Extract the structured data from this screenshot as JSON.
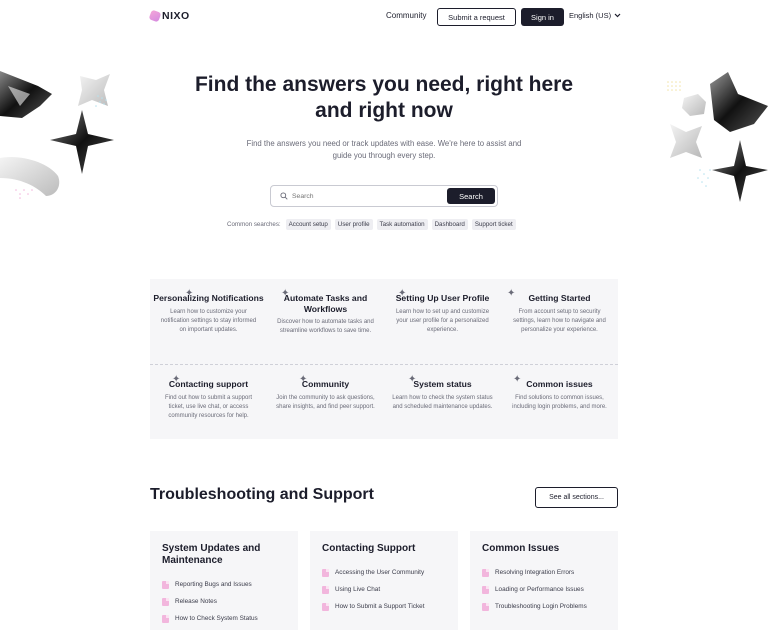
{
  "header": {
    "logo_text": "NIXO",
    "nav_community": "Community",
    "submit_request": "Submit a request",
    "sign_in": "Sign in",
    "language": "English (US)"
  },
  "hero": {
    "title": "Find the answers you need, right here and right now",
    "subtitle": "Find the answers you need or track updates with ease. We're here to assist and guide you through every step.",
    "search_placeholder": "Search",
    "search_button": "Search",
    "common_label": "Common searches:",
    "common_searches": [
      "Account setup",
      "User profile",
      "Task automation",
      "Dashboard",
      "Support ticket"
    ]
  },
  "categories": [
    {
      "title": "Personalizing Notifications",
      "desc": "Learn how to customize your notification settings to stay informed on important updates."
    },
    {
      "title": "Automate Tasks and Workflows",
      "desc": "Discover how to automate tasks and streamline workflows to save time."
    },
    {
      "title": "Setting Up User Profile",
      "desc": "Learn how to set up and customize your user profile for a personalized experience."
    },
    {
      "title": "Getting Started",
      "desc": "From account setup to security settings, learn how to navigate and personalize your experience."
    },
    {
      "title": "Contacting support",
      "desc": "Find out how to submit a support ticket, use live chat, or access community resources for help."
    },
    {
      "title": "Community",
      "desc": "Join the community to ask questions, share insights, and find peer support."
    },
    {
      "title": "System status",
      "desc": "Learn how to check the system status and scheduled maintenance updates."
    },
    {
      "title": "Common issues",
      "desc": "Find solutions to common issues, including login problems, and more."
    }
  ],
  "troubleshooting": {
    "title": "Troubleshooting and Support",
    "see_all": "See all sections...",
    "cards": [
      {
        "title": "System Updates and Maintenance",
        "items": [
          "Reporting Bugs and Issues",
          "Release Notes",
          "How to Check System Status"
        ]
      },
      {
        "title": "Contacting Support",
        "items": [
          "Accessing the User Community",
          "Using Live Chat",
          "How to Submit a Support Ticket"
        ]
      },
      {
        "title": "Common Issues",
        "items": [
          "Resolving Integration Errors",
          "Loading or Performance Issues",
          "Troubleshooting Login Problems"
        ]
      }
    ]
  },
  "colors": {
    "primary": "#1c1d2b",
    "accent": "#f2b6dd",
    "panel": "#f6f6f8"
  }
}
